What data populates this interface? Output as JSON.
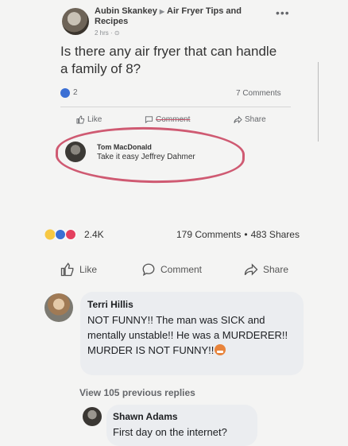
{
  "embedded_post": {
    "author": "Aubin Skankey",
    "group": "Air Fryer Tips and Recipes",
    "time": "2 hrs",
    "question": "Is there any air fryer that can handle a family of 8?",
    "reaction_count": "2",
    "comments_count": "7 Comments",
    "actions": {
      "like": "Like",
      "comment": "Comment",
      "share": "Share"
    },
    "comment": {
      "author": "Tom MacDonald",
      "text": "Take it easy Jeffrey Dahmer"
    }
  },
  "post": {
    "reaction_count": "2.4K",
    "comments_count": "179 Comments",
    "shares_count": "483 Shares",
    "actions": {
      "like": "Like",
      "comment": "Comment",
      "share": "Share"
    }
  },
  "comments": [
    {
      "author": "Terri Hillis",
      "text": "NOT FUNNY!! The man was SICK and mentally unstable!! He was a MURDERER!! MURDER IS NOT FUNNY!!"
    }
  ],
  "view_more": "View 105 previous replies",
  "reply": {
    "author": "Shawn Adams",
    "text": "First day on the internet?"
  },
  "colors": {
    "highlight_oval": "#cf5a72",
    "like_blue": "#3b6fd4",
    "love_red": "#e4405f",
    "haha_yellow": "#f7c843"
  }
}
